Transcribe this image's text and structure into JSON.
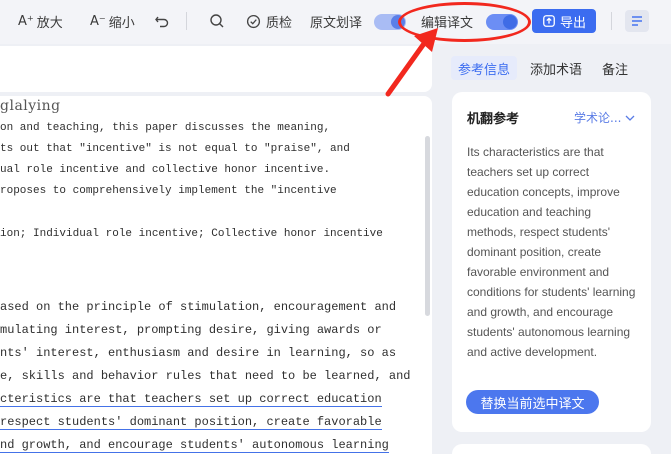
{
  "toolbar": {
    "enlarge": "放大",
    "enlarge_prefix": "A⁺",
    "shrink": "缩小",
    "shrink_prefix": "A⁻",
    "quality": "质检",
    "original_line": "原文划译",
    "edit_translation": "编辑译文",
    "export": "导出"
  },
  "doc": {
    "heading_fragment": "glalying",
    "lines": [
      "on and teaching, this paper discusses the meaning,",
      "ts out that \"incentive\" is not equal to \"praise\", and",
      "ual role incentive and collective honor incentive.",
      "roposes to comprehensively implement the \"incentive",
      "ion; Individual role incentive; Collective honor incentive",
      "ased on the principle of stimulation, encouragement and",
      "mulating interest, prompting desire, giving awards or",
      "nts' interest, enthusiasm and desire in learning, so as",
      "e, skills and behavior rules that need to be learned, and",
      "cteristics are that teachers set up correct education",
      "respect students' dominant position, create favorable",
      "nd growth, and encourage students' autonomous learning"
    ]
  },
  "right_panel": {
    "tabs": [
      "参考信息",
      "添加术语",
      "备注"
    ],
    "card_title": "机翻参考",
    "dropdown": "学术论...",
    "reference_text": "Its characteristics are that teachers set up correct education concepts, improve education and teaching methods, respect students' dominant position, create favorable environment and conditions for students' learning and growth, and encourage students' autonomous learning and active development.",
    "replace_button": "替换当前选中译文"
  },
  "colors": {
    "accent": "#3b6cf0",
    "annotation": "#f2281e"
  }
}
